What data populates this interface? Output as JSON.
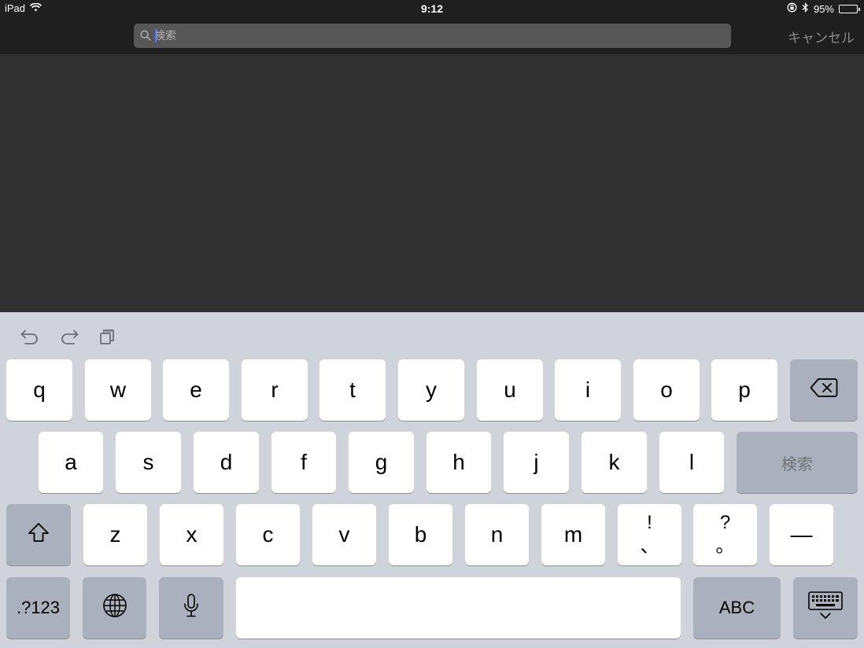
{
  "status_bar": {
    "device": "iPad",
    "time": "9:12",
    "battery_percent_label": "95%",
    "battery_level": 0.95
  },
  "search": {
    "placeholder": "検索",
    "cancel_label": "キャンセル"
  },
  "keyboard": {
    "row1": [
      "q",
      "w",
      "e",
      "r",
      "t",
      "y",
      "u",
      "i",
      "o",
      "p"
    ],
    "row2": [
      "a",
      "s",
      "d",
      "f",
      "g",
      "h",
      "j",
      "k",
      "l"
    ],
    "search_key_label": "検索",
    "row3": [
      "z",
      "x",
      "c",
      "v",
      "b",
      "n",
      "m"
    ],
    "exclaim_key": {
      "top": "!",
      "bottom": "、"
    },
    "question_key": {
      "top": "?",
      "bottom": "。"
    },
    "dash_key": "—",
    "numbers_key": ".?123",
    "abc_key": "ABC"
  },
  "icons": {
    "undo": "undo-icon",
    "redo": "redo-icon",
    "paste": "paste-icon",
    "delete": "delete-icon",
    "shift": "shift-icon",
    "globe": "globe-icon",
    "mic": "microphone-icon",
    "hide_keyboard": "hide-keyboard-icon"
  },
  "colors": {
    "caret": "#4f6fff",
    "keyboard_bg": "#d0d3da",
    "dark_key": "#abb1bc"
  }
}
